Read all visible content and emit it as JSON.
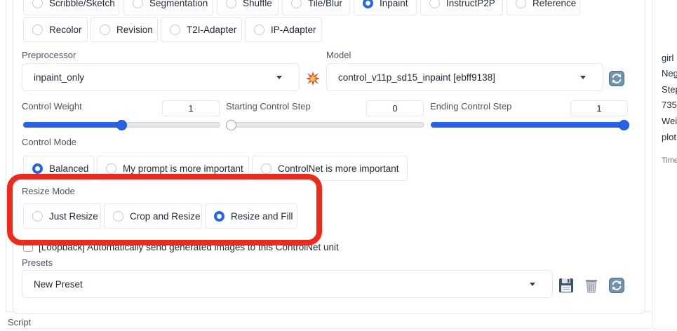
{
  "control_type": {
    "row1": [
      "Scribble/Sketch",
      "Segmentation",
      "Shuffle",
      "Tile/Blur",
      "Inpaint",
      "InstructP2P",
      "Reference"
    ],
    "row2": [
      "Recolor",
      "Revision",
      "T2I-Adapter",
      "IP-Adapter"
    ],
    "selected": "Inpaint"
  },
  "preprocessor": {
    "label": "Preprocessor",
    "value": "inpaint_only"
  },
  "model": {
    "label": "Model",
    "value": "control_v11p_sd15_inpaint [ebff9138]"
  },
  "control_weight": {
    "label": "Control Weight",
    "value": "1",
    "fraction": 0.5
  },
  "starting_step": {
    "label": "Starting Control Step",
    "value": "0",
    "fraction": 0.0
  },
  "ending_step": {
    "label": "Ending Control Step",
    "value": "1",
    "fraction": 1.0
  },
  "control_mode": {
    "label": "Control Mode",
    "options": [
      "Balanced",
      "My prompt is more important",
      "ControlNet is more important"
    ],
    "selected": "Balanced"
  },
  "resize_mode": {
    "label": "Resize Mode",
    "options": [
      "Just Resize",
      "Crop and Resize",
      "Resize and Fill"
    ],
    "selected": "Resize and Fill"
  },
  "loopback": {
    "label": "[Loopback] Automatically send generated images to this ControlNet unit",
    "checked": false
  },
  "presets": {
    "label": "Presets",
    "value": "New Preset"
  },
  "script": {
    "label": "Script"
  },
  "right_panel": {
    "lines": [
      "girl",
      "Neg",
      "Step",
      "735",
      "Wei",
      "plot"
    ],
    "time_label": "Time"
  },
  "colors": {
    "accent": "#2563eb",
    "highlight": "#f02a1a"
  }
}
